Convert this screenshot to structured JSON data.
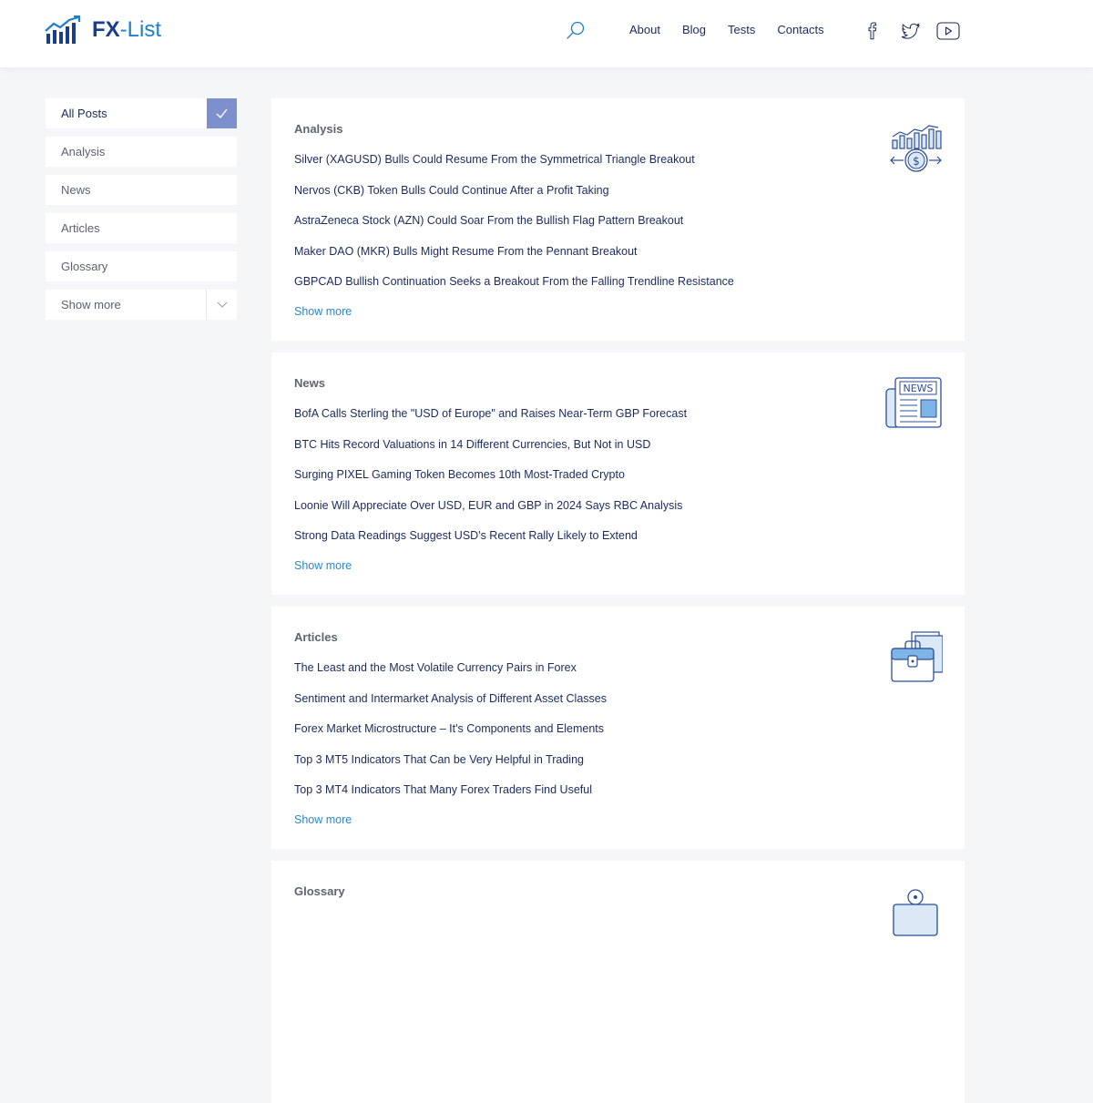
{
  "header": {
    "logo": {
      "bold": "FX",
      "rest": "-List"
    },
    "nav": [
      "About",
      "Blog",
      "Tests",
      "Contacts"
    ],
    "icons": [
      "search-icon",
      "facebook-icon",
      "twitter-icon",
      "youtube-icon"
    ]
  },
  "sidebar": {
    "items": [
      "All Posts",
      "Analysis",
      "News",
      "Articles",
      "Glossary",
      "Show more"
    ],
    "active": "All Posts"
  },
  "sections": [
    {
      "title": "Analysis",
      "icon": "analysis-chart-icon",
      "links": [
        "Silver (XAGUSD) Bulls Could Resume From the Symmetrical Triangle Breakout",
        "Nervos (CKB) Token Bulls Could Continue After a Profit Taking",
        "AstraZeneca Stock (AZN) Could Soar From the Bullish Flag Pattern Breakout",
        "Maker DAO (MKR) Bulls Might Resume From the Pennant Breakout",
        "GBPCAD Bullish Continuation Seeks a Breakout From the Falling Trendline Resistance"
      ],
      "more": "Show more"
    },
    {
      "title": "News",
      "icon": "newspaper-icon",
      "icon_text": "NEWS",
      "links": [
        "BofA Calls Sterling the \"USD of Europe\" and Raises Near-Term GBP Forecast",
        "BTC Hits Record Valuations in 14 Different Currencies, But Not in USD",
        "Surging PIXEL Gaming Token Becomes 10th Most-Traded Crypto",
        "Loonie Will Appreciate Over USD, EUR and GBP in 2024 Says RBC Analysis",
        "Strong Data Readings Suggest USD's Recent Rally Likely to Extend"
      ],
      "more": "Show more"
    },
    {
      "title": "Articles",
      "icon": "briefcase-documents-icon",
      "links": [
        "The Least and the Most Volatile Currency Pairs in Forex",
        "Sentiment and Intermarket Analysis of Different Asset Classes",
        "Forex Market Microstructure – It's Components and Elements",
        "Top 3 MT5 Indicators That Can be Very Helpful in Trading",
        "Top 3 MT4 Indicators That Many Forex Traders Find Useful"
      ],
      "more": "Show more"
    },
    {
      "title": "Glossary",
      "icon": "glossary-icon"
    }
  ],
  "colors": {
    "brand_dark": "#1b3d8c",
    "brand_light": "#1e80c8",
    "accent": "#7e8fcd",
    "link": "#1b2a5c",
    "show_more": "#2f86c5"
  }
}
